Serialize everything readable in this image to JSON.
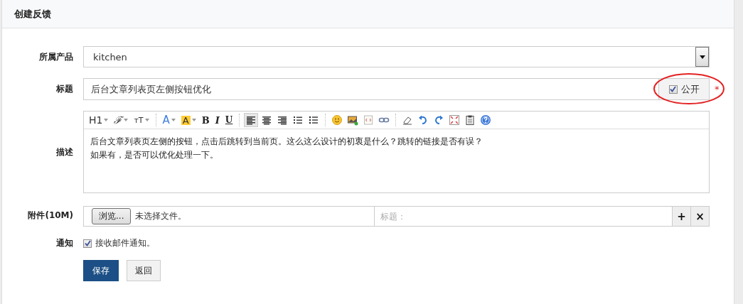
{
  "panel": {
    "title": "创建反馈"
  },
  "product": {
    "label": "所属产品",
    "value": "kitchen"
  },
  "title": {
    "label": "标题",
    "value": "后台文章列表页左侧按钮优化",
    "public_label": "公开",
    "public_checked": true,
    "required_mark": "*",
    "circled": true
  },
  "description": {
    "label": "描述",
    "toolbar": [
      {
        "items": [
          {
            "kind": "heading",
            "label": "H1"
          },
          {
            "kind": "font",
            "label": "ℱ"
          },
          {
            "kind": "size",
            "label": "тT"
          }
        ]
      },
      {
        "items": [
          {
            "kind": "forecolor",
            "label": "A"
          },
          {
            "kind": "backcolor",
            "label": "A"
          },
          {
            "kind": "bold",
            "label": "B"
          },
          {
            "kind": "italic",
            "label": "I"
          },
          {
            "kind": "underline",
            "label": "U"
          }
        ]
      },
      {
        "items": [
          {
            "kind": "alignleft",
            "selected": true
          },
          {
            "kind": "aligncenter",
            "selected": false
          },
          {
            "kind": "alignright",
            "selected": false
          },
          {
            "kind": "orderedlist"
          },
          {
            "kind": "bulletlist"
          }
        ]
      },
      {
        "items": [
          {
            "kind": "emotion"
          },
          {
            "kind": "image"
          },
          {
            "kind": "code"
          },
          {
            "kind": "link"
          }
        ]
      },
      {
        "items": [
          {
            "kind": "eraser"
          },
          {
            "kind": "undo"
          },
          {
            "kind": "redo"
          },
          {
            "kind": "fullscreen"
          },
          {
            "kind": "paste"
          },
          {
            "kind": "help"
          }
        ]
      }
    ],
    "lines": [
      "后台文章列表页左侧的按钮，点击后跳转到当前页。这么这么设计的初衷是什么？跳转的链接是否有误？",
      "如果有，是否可以优化处理一下。"
    ]
  },
  "attachment": {
    "label": "附件(10M)",
    "browse": "浏览...",
    "file_status": "未选择文件。",
    "title_placeholder": "标题：",
    "add": "+",
    "remove": "×"
  },
  "notify": {
    "label": "通知",
    "checked": true,
    "text": "接收邮件通知。"
  },
  "buttons": [
    {
      "kind": "primary",
      "label": "保存"
    },
    {
      "kind": "default",
      "label": "返回"
    }
  ]
}
